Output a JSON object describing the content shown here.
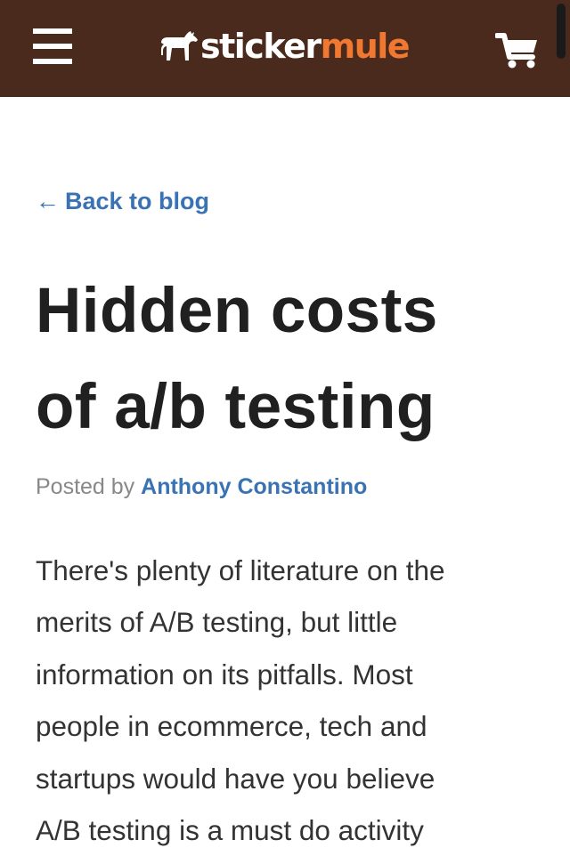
{
  "header": {
    "logo_part1": "sticker",
    "logo_part2": "mule",
    "background_color": "#4a2a1c",
    "accent_color": "#f07830",
    "menu_icon": "hamburger-menu-icon",
    "cart_icon": "shopping-cart-icon"
  },
  "back_link": {
    "arrow": "←",
    "label": "Back to blog"
  },
  "article": {
    "title_line1": "Hidden costs",
    "title_line2": "of a/b testing",
    "posted_by_prefix": "Posted by",
    "author": "Anthony Constantino",
    "body_lines": [
      "There's plenty of literature on the",
      "merits of A/B testing, but little",
      "information on its pitfalls. Most",
      "people in ecommerce, tech and",
      "startups would have you believe",
      "A/B testing is a must do activity"
    ]
  },
  "colors": {
    "link": "#3a73b4",
    "title": "#202020",
    "body": "#333333",
    "muted": "#888888"
  }
}
